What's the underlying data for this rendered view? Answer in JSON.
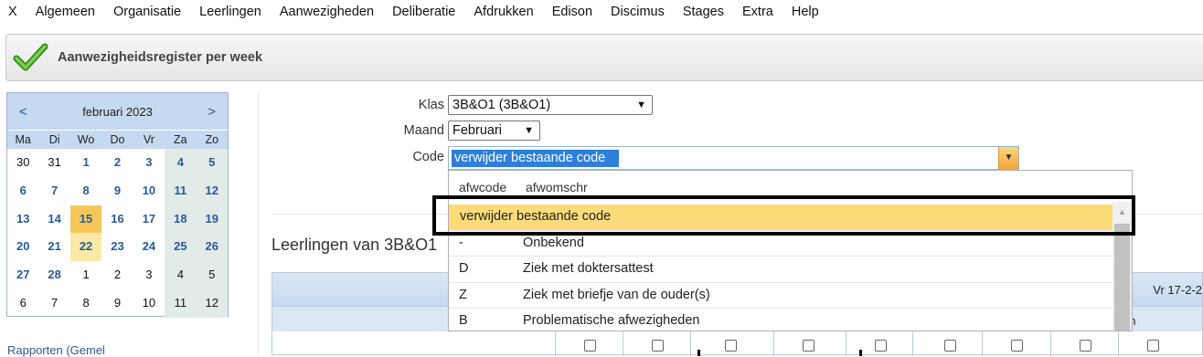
{
  "menu": [
    "X",
    "Algemeen",
    "Organisatie",
    "Leerlingen",
    "Aanwezigheden",
    "Deliberatie",
    "Afdrukken",
    "Edison",
    "Discimus",
    "Stages",
    "Extra",
    "Help"
  ],
  "page_title": "Aanwezigheidsregister per week",
  "calendar": {
    "prev": "<",
    "next": ">",
    "month": "februari 2023",
    "dow": [
      "Ma",
      "Di",
      "Wo",
      "Do",
      "Vr",
      "Za",
      "Zo"
    ],
    "weeks": [
      [
        "30",
        "31",
        "1",
        "2",
        "3",
        "4",
        "5"
      ],
      [
        "6",
        "7",
        "8",
        "9",
        "10",
        "11",
        "12"
      ],
      [
        "13",
        "14",
        "15",
        "16",
        "17",
        "18",
        "19"
      ],
      [
        "20",
        "21",
        "22",
        "23",
        "24",
        "25",
        "26"
      ],
      [
        "27",
        "28",
        "1",
        "2",
        "3",
        "4",
        "5"
      ],
      [
        "6",
        "7",
        "8",
        "9",
        "10",
        "11",
        "12"
      ]
    ],
    "today": "15",
    "selected": "22"
  },
  "left_link": "Rapporten (Gemel",
  "form": {
    "klas_label": "Klas",
    "klas_value": "3B&O1 (3B&O1)",
    "maand_label": "Maand",
    "maand_value": "Februari",
    "code_label": "Code",
    "code_value": "verwijder bestaande code"
  },
  "dropdown": {
    "col1": "afwcode",
    "col2": "afwomschr",
    "rows": [
      {
        "code": "",
        "desc": "verwijder bestaande code",
        "highlighted": true
      },
      {
        "code": "-",
        "desc": "Onbekend"
      },
      {
        "code": "D",
        "desc": "Ziek met doktersattest"
      },
      {
        "code": "Z",
        "desc": "Ziek met briefje van de ouder(s)"
      },
      {
        "code": "B",
        "desc": "Problematische afwezigheden"
      }
    ]
  },
  "section_title": "Leerlingen van 3B&O1",
  "grid": {
    "day_header": "Vr 17-2-2",
    "sub_header": "Vm"
  },
  "colors": {
    "accent_blue": "#2b5a94",
    "highlight_yellow": "#fbdc78",
    "selection_blue": "#2e7fd8"
  }
}
